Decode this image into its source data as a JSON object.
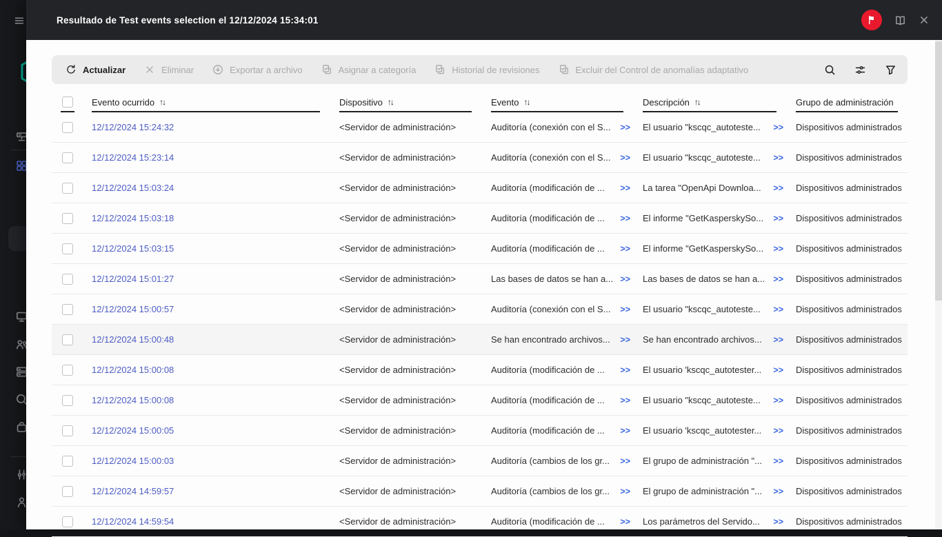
{
  "header": {
    "title": "Resultado de Test events selection el 12/12/2024 15:34:01",
    "badge_color": "#e8192c"
  },
  "sidebar": {
    "items": [
      {
        "icon": "menu-icon"
      },
      {
        "icon": "logo-hexagon-icon"
      },
      {
        "icon": "devices-server-icon"
      },
      {
        "icon": "apps-grid-icon"
      },
      {
        "icon": "monitoring-monitor-icon"
      },
      {
        "icon": "users-icon"
      },
      {
        "icon": "servers-stack-icon"
      },
      {
        "icon": "search-icon"
      },
      {
        "icon": "marketplace-bag-icon"
      },
      {
        "icon": "console-settings-icon"
      },
      {
        "icon": "account-person-icon"
      }
    ],
    "active_color": "#4e68cf",
    "logo_color": "#00b39b"
  },
  "toolbar": {
    "buttons": [
      {
        "label": "Actualizar",
        "icon": "refresh-icon",
        "enabled": true
      },
      {
        "label": "Eliminar",
        "icon": "close-icon",
        "enabled": false
      },
      {
        "label": "Exportar a archivo",
        "icon": "download-icon",
        "enabled": false
      },
      {
        "label": "Asignar a categoría",
        "icon": "clipboard-check-icon",
        "enabled": false
      },
      {
        "label": "Historial de revisiones",
        "icon": "clipboard-check-icon",
        "enabled": false
      },
      {
        "label": "Excluir del Control de anomalías adaptativo",
        "icon": "clipboard-check-icon",
        "enabled": false
      }
    ],
    "right_icons": [
      "search-icon",
      "settings-sliders-icon",
      "filter-funnel-icon"
    ]
  },
  "table": {
    "columns": [
      {
        "label": "Evento ocurrido",
        "sort": "↑↓"
      },
      {
        "label": "Dispositivo",
        "sort": "↑↓"
      },
      {
        "label": "Evento",
        "sort": "↑↓"
      },
      {
        "label": "Descripción",
        "sort": "↑↓"
      },
      {
        "label": "Grupo de administración",
        "sort": "↑"
      }
    ],
    "expand_label": ">>",
    "rows": [
      {
        "time": "12/12/2024 15:24:32",
        "device": "<Servidor de administración>",
        "event": "Auditoría (conexión con el S...",
        "description": "El usuario \"kscqc_autoteste...",
        "group": "Dispositivos administrados",
        "highlighted": false
      },
      {
        "time": "12/12/2024 15:23:14",
        "device": "<Servidor de administración>",
        "event": "Auditoría (conexión con el S...",
        "description": "El usuario \"kscqc_autoteste...",
        "group": "Dispositivos administrados",
        "highlighted": false
      },
      {
        "time": "12/12/2024 15:03:24",
        "device": "<Servidor de administración>",
        "event": "Auditoría (modificación de ...",
        "description": "La tarea \"OpenApi Downloa...",
        "group": "Dispositivos administrados",
        "highlighted": false
      },
      {
        "time": "12/12/2024 15:03:18",
        "device": "<Servidor de administración>",
        "event": "Auditoría (modificación de ...",
        "description": "El informe \"GetKasperskySo...",
        "group": "Dispositivos administrados",
        "highlighted": false
      },
      {
        "time": "12/12/2024 15:03:15",
        "device": "<Servidor de administración>",
        "event": "Auditoría (modificación de ...",
        "description": "El informe \"GetKasperskySo...",
        "group": "Dispositivos administrados",
        "highlighted": false
      },
      {
        "time": "12/12/2024 15:01:27",
        "device": "<Servidor de administración>",
        "event": "Las bases de datos se han a...",
        "description": "Las bases de datos se han a...",
        "group": "Dispositivos administrados",
        "highlighted": false
      },
      {
        "time": "12/12/2024 15:00:57",
        "device": "<Servidor de administración>",
        "event": "Auditoría (conexión con el S...",
        "description": "El usuario \"kscqc_autoteste...",
        "group": "Dispositivos administrados",
        "highlighted": false
      },
      {
        "time": "12/12/2024 15:00:48",
        "device": "<Servidor de administración>",
        "event": "Se han encontrado archivos...",
        "description": "Se han encontrado archivos...",
        "group": "Dispositivos administrados",
        "highlighted": true
      },
      {
        "time": "12/12/2024 15:00:08",
        "device": "<Servidor de administración>",
        "event": "Auditoría (modificación de ...",
        "description": "El usuario 'kscqc_autotester...",
        "group": "Dispositivos administrados",
        "highlighted": false
      },
      {
        "time": "12/12/2024 15:00:08",
        "device": "<Servidor de administración>",
        "event": "Auditoría (modificación de ...",
        "description": "El usuario \"kscqc_autoteste...",
        "group": "Dispositivos administrados",
        "highlighted": false
      },
      {
        "time": "12/12/2024 15:00:05",
        "device": "<Servidor de administración>",
        "event": "Auditoría (modificación de ...",
        "description": "El usuario 'kscqc_autotester...",
        "group": "Dispositivos administrados",
        "highlighted": false
      },
      {
        "time": "12/12/2024 15:00:03",
        "device": "<Servidor de administración>",
        "event": "Auditoría (cambios de los gr...",
        "description": "El grupo de administración \"...",
        "group": "Dispositivos administrados",
        "highlighted": false
      },
      {
        "time": "12/12/2024 14:59:57",
        "device": "<Servidor de administración>",
        "event": "Auditoría (cambios de los gr...",
        "description": "El grupo de administración \"...",
        "group": "Dispositivos administrados",
        "highlighted": false
      },
      {
        "time": "12/12/2024 14:59:54",
        "device": "<Servidor de administración>",
        "event": "Auditoría (modificación de ...",
        "description": "Los parámetros del Servido...",
        "group": "Dispositivos administrados",
        "highlighted": false
      }
    ]
  },
  "colors": {
    "header_bg": "#232427",
    "sidebar_bg": "#17181b",
    "toolbar_bg": "#ebebeb",
    "link_time": "#4d5cc4",
    "link_expand": "#3a66e0",
    "row_highlight": "#f5f5f5"
  }
}
